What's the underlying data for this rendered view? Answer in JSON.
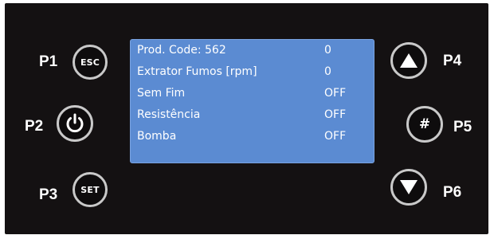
{
  "buttons": {
    "p1": {
      "label": "P1",
      "text": "ESC"
    },
    "p2": {
      "label": "P2",
      "icon": "power-icon"
    },
    "p3": {
      "label": "P3",
      "text": "SET"
    },
    "p4": {
      "label": "P4",
      "icon": "arrow-up-icon"
    },
    "p5": {
      "label": "P5",
      "text": "#"
    },
    "p6": {
      "label": "P6",
      "icon": "arrow-down-icon"
    }
  },
  "display": {
    "background_color": "#5b8bd2",
    "rows": [
      {
        "label": "Prod. Code: 562",
        "value": "0"
      },
      {
        "label": "Extrator Fumos [rpm]",
        "value": "0"
      },
      {
        "label": "Sem Fim",
        "value": "OFF"
      },
      {
        "label": "Resistência",
        "value": "OFF"
      },
      {
        "label": "Bomba",
        "value": "OFF"
      }
    ]
  }
}
